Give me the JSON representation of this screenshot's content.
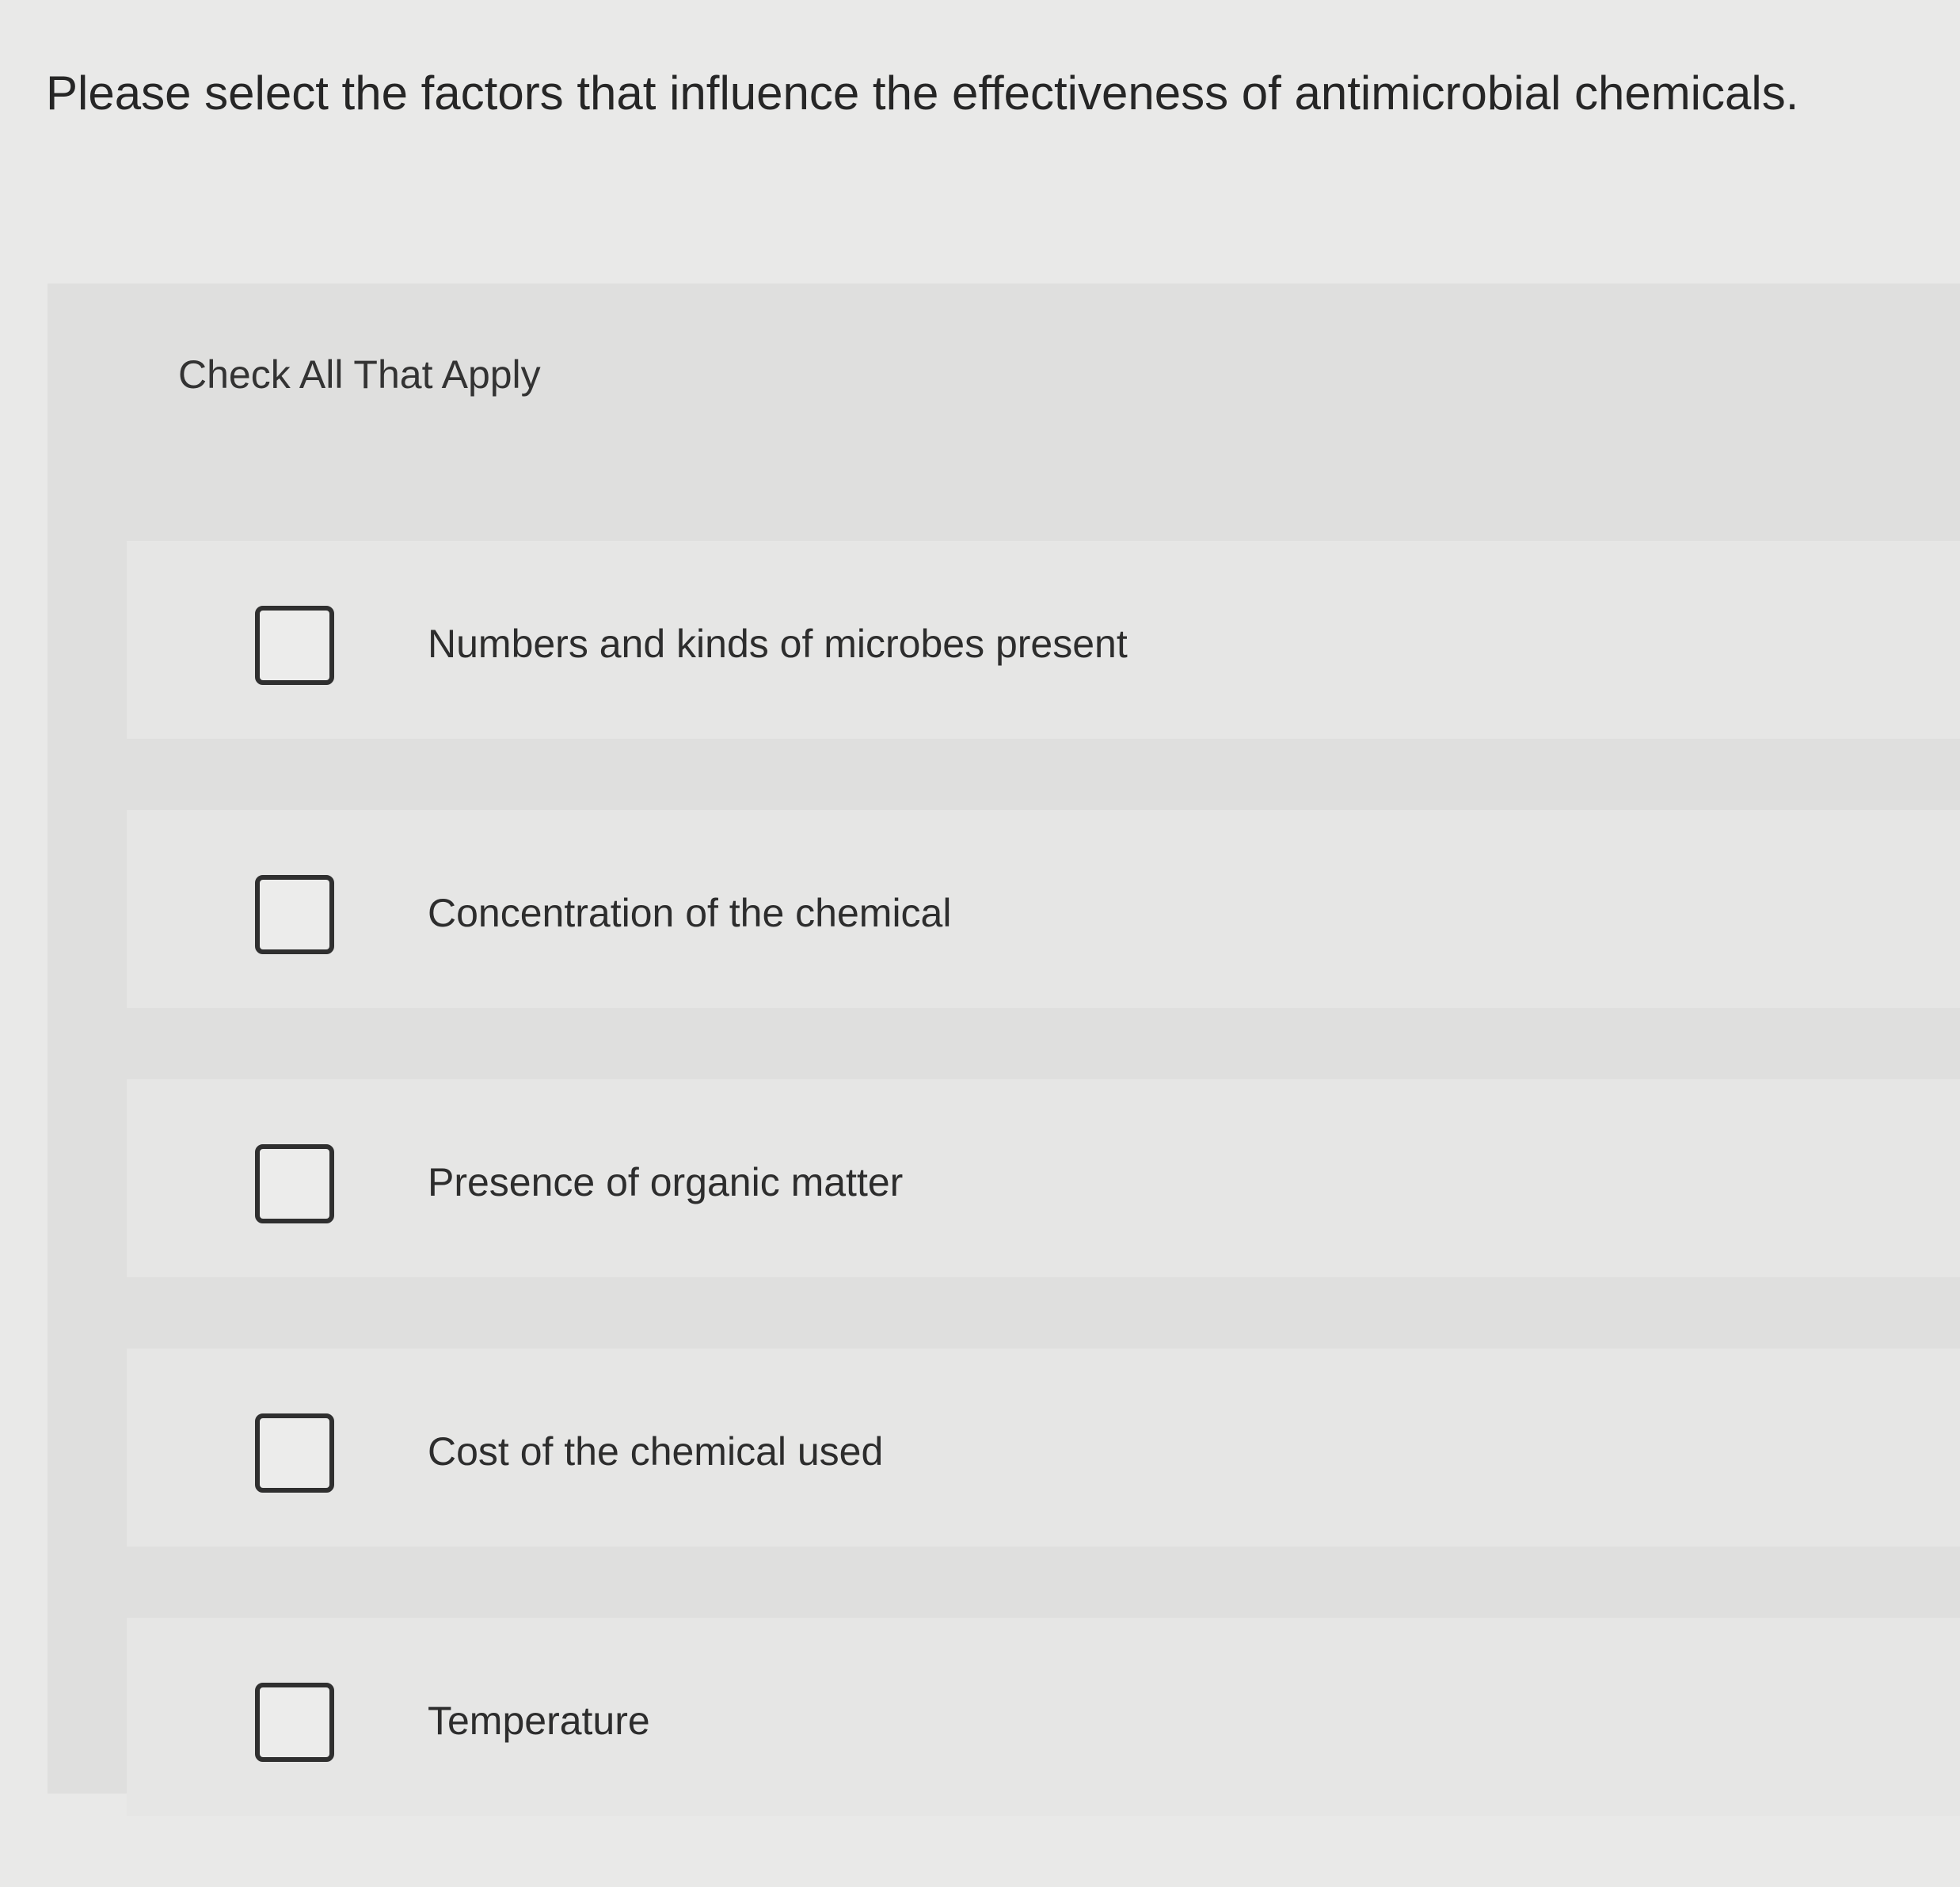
{
  "question": {
    "text": "Please select the factors that influence the effectiveness of antimicrobial chemicals."
  },
  "instruction": "Check All That Apply",
  "options": [
    {
      "label": "Numbers and kinds of microbes present",
      "checked": false
    },
    {
      "label": "Concentration of the chemical",
      "checked": false
    },
    {
      "label": "Presence of organic matter",
      "checked": false
    },
    {
      "label": "Cost of the chemical used",
      "checked": false
    },
    {
      "label": "Temperature",
      "checked": false
    }
  ]
}
